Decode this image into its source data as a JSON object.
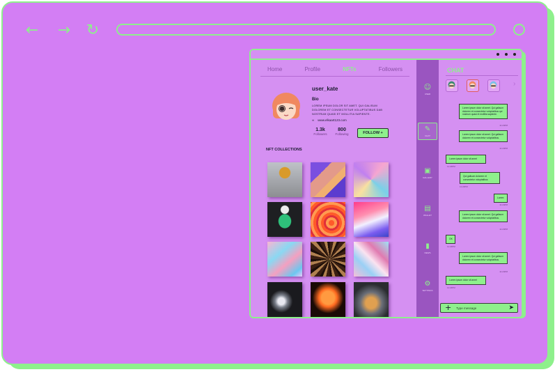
{
  "browser": {
    "back_icon": "arrow-left-icon",
    "forward_icon": "arrow-right-icon",
    "reload_icon": "reload-icon",
    "menu_icon": "circle-icon"
  },
  "app": {
    "tabs": [
      {
        "label": "Home"
      },
      {
        "label": "Profile"
      },
      {
        "label": "NFTs",
        "active": true
      },
      {
        "label": "Followers"
      }
    ],
    "profile": {
      "username": "user_kate",
      "bio_title": "Bio",
      "bio_text": "LOREM IPSUM DOLOR SIT AMET. QUI GALISUM DOLOREM ET CONSECTETUR VOLUPTATIBUS DAB NOSTRUM QUASI ET MOLLITIA SAPIENTE.",
      "link_icon": "link-icon",
      "link_text": "www.elkaart123.com",
      "followers_count": "1.3k",
      "followers_label": "Followers",
      "following_count": "800",
      "following_label": "Following",
      "follow_button": "FOLLOW +"
    },
    "collections_title": "NFT COLLECTIONS",
    "sidenav": [
      {
        "label": "USER",
        "icon": "avatar-icon"
      },
      {
        "label": "CHAT",
        "icon": "chat-icon",
        "active": true
      },
      {
        "label": "GALLERY",
        "icon": "image-icon"
      },
      {
        "label": "WALLET",
        "icon": "wallet-icon"
      },
      {
        "label": "NEWS",
        "icon": "document-icon"
      },
      {
        "label": "SETTINGS",
        "icon": "gear-icon"
      }
    ],
    "chat": {
      "title": "CHAT",
      "next_icon": "chevron-right-icon",
      "messages": [
        {
          "side": "right",
          "text": "Lorem ipsum dolor sit amet. Qui galisum dolorem et consectetur voluptatibus qui nostrum quasi et mollitia sapiente.",
          "time": "11:24PM"
        },
        {
          "side": "right",
          "text": "Lorem ipsum dolor sit amet. Qui galisum dolorem et consectetur voluptatibus.",
          "time": "11:24PM"
        },
        {
          "side": "left",
          "text": "Lorem ipsum dolor sit amet",
          "time": "11:24PM"
        },
        {
          "side": "left",
          "text": "Qui galisum dolorem et consectetur voluptatibus",
          "time": "11:24PM"
        },
        {
          "side": "right",
          "text": "Lorem",
          "time": "11:24PM"
        },
        {
          "side": "right",
          "text": "Lorem ipsum dolor sit amet. Qui galisum dolorem et consectetur voluptatibus.",
          "time": "11:24PM"
        },
        {
          "side": "left",
          "text": "OK",
          "time": "11:24PM"
        },
        {
          "side": "right",
          "text": "Lorem ipsum dolor sit amet. Qui galisum dolorem et consectetur voluptatibus.",
          "time": "11:24PM"
        },
        {
          "side": "left",
          "text": "Lorem ipsum dolor sit amet",
          "time": "11:24PM"
        }
      ],
      "composer_placeholder": "Type message",
      "plus_icon": "plus-icon",
      "send_icon": "send-icon"
    }
  },
  "colors": {
    "background": "#d37ef4",
    "accent": "#8ef08c",
    "sidebar": "#9a55c0",
    "text": "#1a1a2e"
  }
}
